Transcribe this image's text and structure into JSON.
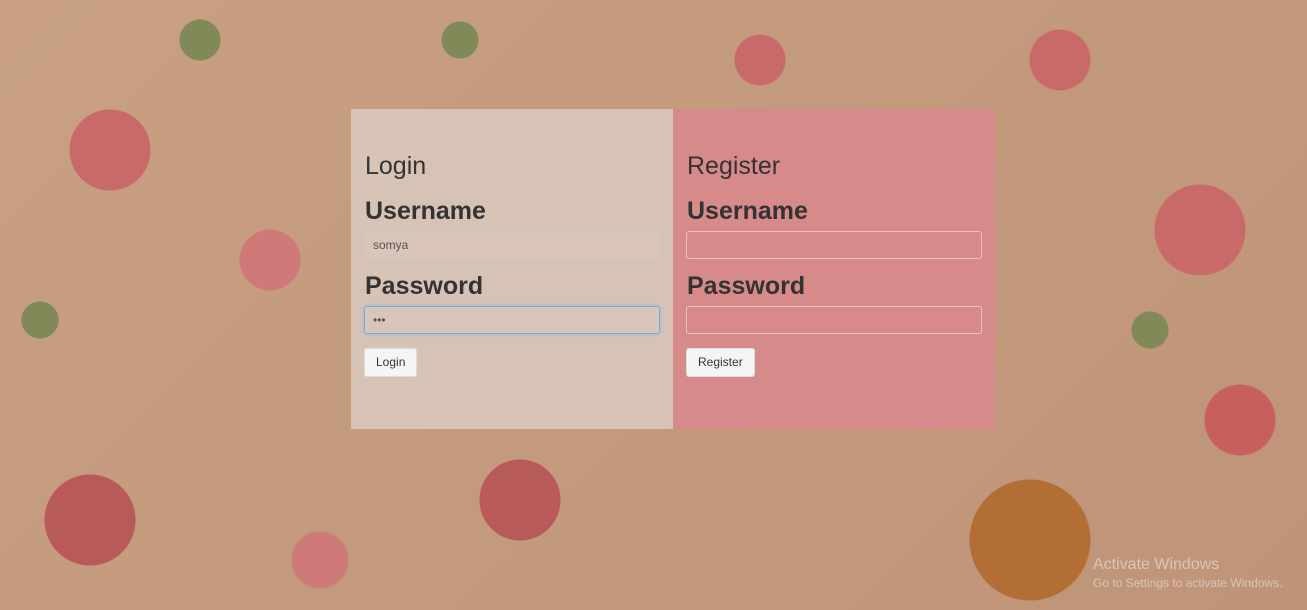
{
  "login": {
    "title": "Login",
    "username_label": "Username",
    "username_value": "somya",
    "password_label": "Password",
    "password_value": "•••",
    "button_label": "Login"
  },
  "register": {
    "title": "Register",
    "username_label": "Username",
    "username_value": "",
    "password_label": "Password",
    "password_value": "",
    "button_label": "Register"
  },
  "watermark": {
    "line1": "Activate Windows",
    "line2": "Go to Settings to activate Windows."
  },
  "colors": {
    "register_panel": "#d68b8a",
    "login_panel": "rgba(222,210,204,0.72)"
  }
}
